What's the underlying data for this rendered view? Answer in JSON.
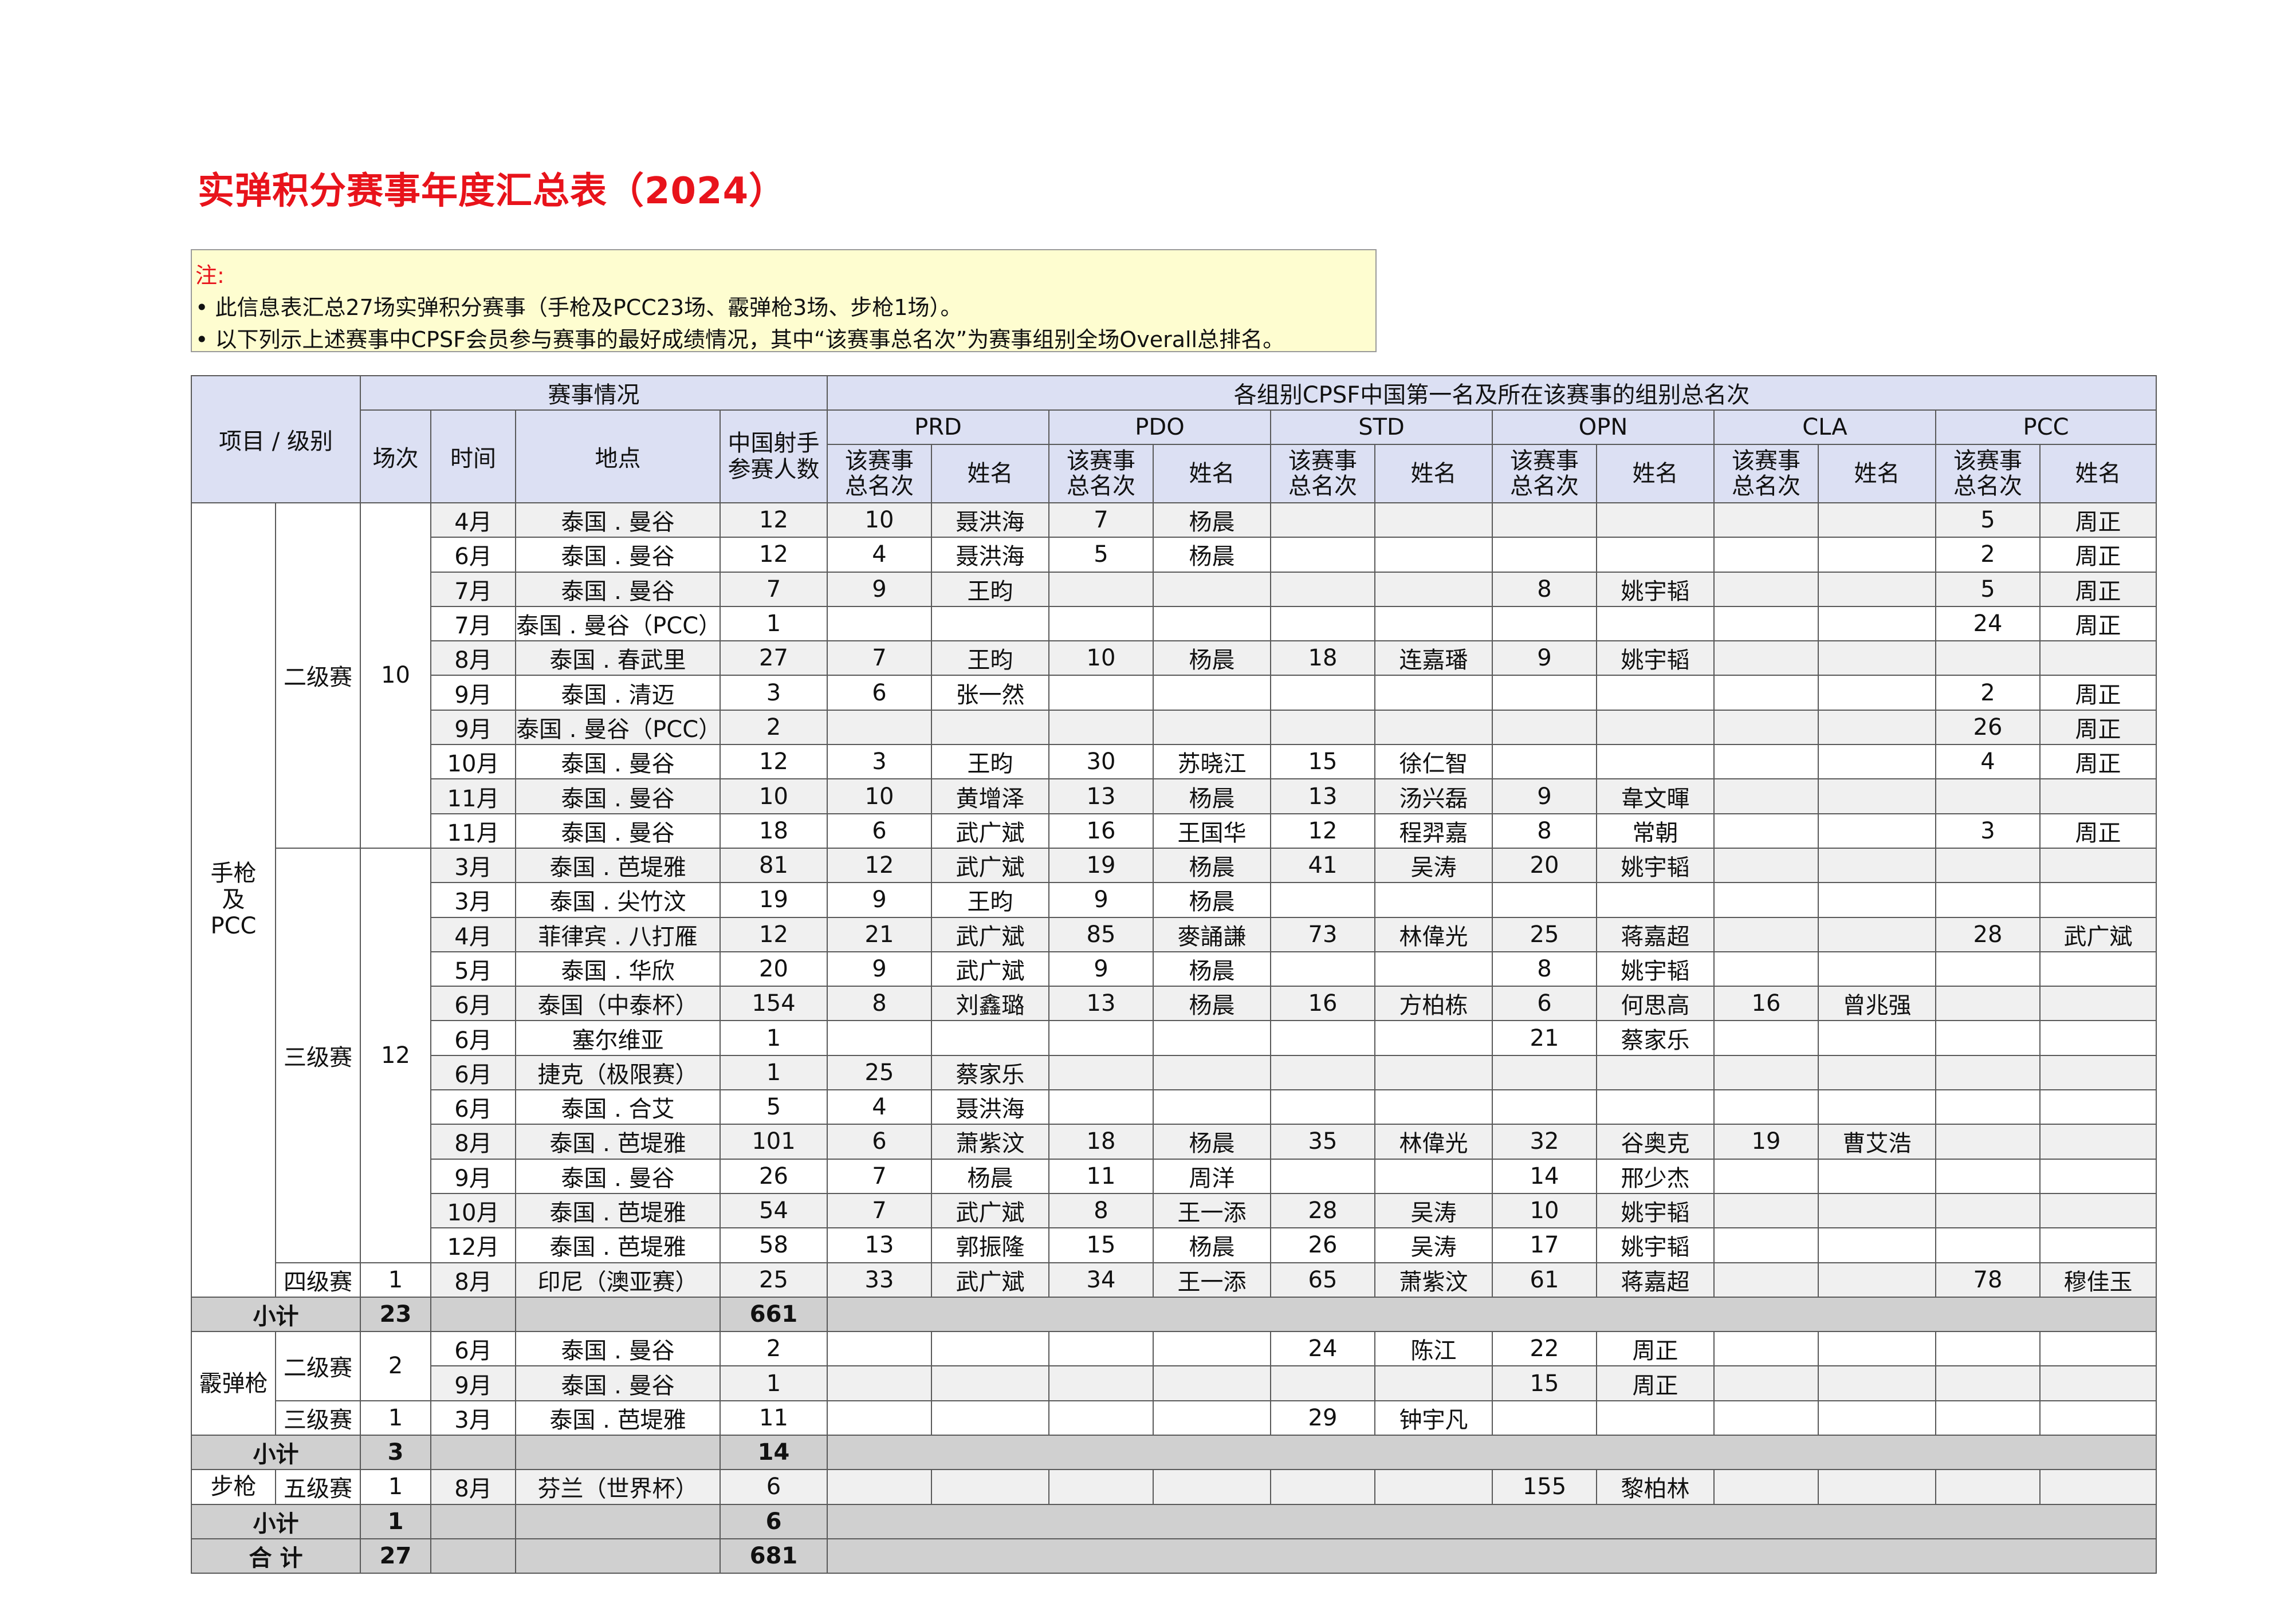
{
  "title": "实弹积分赛事年度汇总表（2024）",
  "note": {
    "label": "注:",
    "lines": [
      "• 此信息表汇总27场实弹积分赛事（手枪及PCC23场、霰弹枪3场、步枪1场）。",
      "• 以下列示上述赛事中CPSF会员参与赛事的最好成绩情况，其中“该赛事总名次”为赛事组别全场Overall总排名。"
    ]
  },
  "header": {
    "item_level": "项目 / 级别",
    "event_info": "赛事情况",
    "results_header": "各组别CPSF中国第一名及所在该赛事的组别总名次",
    "count": "场次",
    "time": "时间",
    "location": "地点",
    "participants": "中国射手参赛人数",
    "divisions": [
      "PRD",
      "PDO",
      "STD",
      "OPN",
      "CLA",
      "PCC"
    ],
    "rank_label": "该赛事总名次",
    "name_label": "姓名"
  },
  "categories": {
    "handgun": "手枪及PCC",
    "shotgun": "霰弹枪",
    "rifle": "步枪"
  },
  "levels": {
    "l2": "二级赛",
    "l3": "三级赛",
    "l4": "四级赛",
    "l5": "五级赛"
  },
  "level_counts": {
    "hg_l2": "10",
    "hg_l3": "12",
    "hg_l4": "1",
    "sg_l2": "2",
    "sg_l3": "1",
    "rf_l5": "1"
  },
  "rows": [
    {
      "time": "4月",
      "loc": "泰国 . 曼谷",
      "n": "12",
      "prd_r": "10",
      "prd_n": "聂洪海",
      "pdo_r": "7",
      "pdo_n": "杨晨",
      "std_r": "",
      "std_n": "",
      "opn_r": "",
      "opn_n": "",
      "cla_r": "",
      "cla_n": "",
      "pcc_r": "5",
      "pcc_n": "周正"
    },
    {
      "time": "6月",
      "loc": "泰国 . 曼谷",
      "n": "12",
      "prd_r": "4",
      "prd_n": "聂洪海",
      "pdo_r": "5",
      "pdo_n": "杨晨",
      "std_r": "",
      "std_n": "",
      "opn_r": "",
      "opn_n": "",
      "cla_r": "",
      "cla_n": "",
      "pcc_r": "2",
      "pcc_n": "周正"
    },
    {
      "time": "7月",
      "loc": "泰国 . 曼谷",
      "n": "7",
      "prd_r": "9",
      "prd_n": "王昀",
      "pdo_r": "",
      "pdo_n": "",
      "std_r": "",
      "std_n": "",
      "opn_r": "8",
      "opn_n": "姚宇韬",
      "cla_r": "",
      "cla_n": "",
      "pcc_r": "5",
      "pcc_n": "周正"
    },
    {
      "time": "7月",
      "loc": "泰国 . 曼谷（PCC）",
      "n": "1",
      "prd_r": "",
      "prd_n": "",
      "pdo_r": "",
      "pdo_n": "",
      "std_r": "",
      "std_n": "",
      "opn_r": "",
      "opn_n": "",
      "cla_r": "",
      "cla_n": "",
      "pcc_r": "24",
      "pcc_n": "周正"
    },
    {
      "time": "8月",
      "loc": "泰国 . 春武里",
      "n": "27",
      "prd_r": "7",
      "prd_n": "王昀",
      "pdo_r": "10",
      "pdo_n": "杨晨",
      "std_r": "18",
      "std_n": "连嘉璠",
      "opn_r": "9",
      "opn_n": "姚宇韬",
      "cla_r": "",
      "cla_n": "",
      "pcc_r": "",
      "pcc_n": ""
    },
    {
      "time": "9月",
      "loc": "泰国 . 清迈",
      "n": "3",
      "prd_r": "6",
      "prd_n": "张一然",
      "pdo_r": "",
      "pdo_n": "",
      "std_r": "",
      "std_n": "",
      "opn_r": "",
      "opn_n": "",
      "cla_r": "",
      "cla_n": "",
      "pcc_r": "2",
      "pcc_n": "周正"
    },
    {
      "time": "9月",
      "loc": "泰国 . 曼谷（PCC）",
      "n": "2",
      "prd_r": "",
      "prd_n": "",
      "pdo_r": "",
      "pdo_n": "",
      "std_r": "",
      "std_n": "",
      "opn_r": "",
      "opn_n": "",
      "cla_r": "",
      "cla_n": "",
      "pcc_r": "26",
      "pcc_n": "周正"
    },
    {
      "time": "10月",
      "loc": "泰国 . 曼谷",
      "n": "12",
      "prd_r": "3",
      "prd_n": "王昀",
      "pdo_r": "30",
      "pdo_n": "苏晓江",
      "std_r": "15",
      "std_n": "徐仁智",
      "opn_r": "",
      "opn_n": "",
      "cla_r": "",
      "cla_n": "",
      "pcc_r": "4",
      "pcc_n": "周正"
    },
    {
      "time": "11月",
      "loc": "泰国 . 曼谷",
      "n": "10",
      "prd_r": "10",
      "prd_n": "黄增泽",
      "pdo_r": "13",
      "pdo_n": "杨晨",
      "std_r": "13",
      "std_n": "汤兴磊",
      "opn_r": "9",
      "opn_n": "韋文暉",
      "cla_r": "",
      "cla_n": "",
      "pcc_r": "",
      "pcc_n": ""
    },
    {
      "time": "11月",
      "loc": "泰国 . 曼谷",
      "n": "18",
      "prd_r": "6",
      "prd_n": "武广斌",
      "pdo_r": "16",
      "pdo_n": "王国华",
      "std_r": "12",
      "std_n": "程羿嘉",
      "opn_r": "8",
      "opn_n": "常朝",
      "cla_r": "",
      "cla_n": "",
      "pcc_r": "3",
      "pcc_n": "周正"
    },
    {
      "time": "3月",
      "loc": "泰国 . 芭堤雅",
      "n": "81",
      "prd_r": "12",
      "prd_n": "武广斌",
      "pdo_r": "19",
      "pdo_n": "杨晨",
      "std_r": "41",
      "std_n": "吴涛",
      "opn_r": "20",
      "opn_n": "姚宇韬",
      "cla_r": "",
      "cla_n": "",
      "pcc_r": "",
      "pcc_n": ""
    },
    {
      "time": "3月",
      "loc": "泰国 . 尖竹汶",
      "n": "19",
      "prd_r": "9",
      "prd_n": "王昀",
      "pdo_r": "9",
      "pdo_n": "杨晨",
      "std_r": "",
      "std_n": "",
      "opn_r": "",
      "opn_n": "",
      "cla_r": "",
      "cla_n": "",
      "pcc_r": "",
      "pcc_n": ""
    },
    {
      "time": "4月",
      "loc": "菲律宾 . 八打雁",
      "n": "12",
      "prd_r": "21",
      "prd_n": "武广斌",
      "pdo_r": "85",
      "pdo_n": "麥誦謙",
      "std_r": "73",
      "std_n": "林偉光",
      "opn_r": "25",
      "opn_n": "蒋嘉超",
      "cla_r": "",
      "cla_n": "",
      "pcc_r": "28",
      "pcc_n": "武广斌"
    },
    {
      "time": "5月",
      "loc": "泰国 . 华欣",
      "n": "20",
      "prd_r": "9",
      "prd_n": "武广斌",
      "pdo_r": "9",
      "pdo_n": "杨晨",
      "std_r": "",
      "std_n": "",
      "opn_r": "8",
      "opn_n": "姚宇韬",
      "cla_r": "",
      "cla_n": "",
      "pcc_r": "",
      "pcc_n": ""
    },
    {
      "time": "6月",
      "loc": "泰国（中泰杯）",
      "n": "154",
      "prd_r": "8",
      "prd_n": "刘鑫璐",
      "pdo_r": "13",
      "pdo_n": "杨晨",
      "std_r": "16",
      "std_n": "方柏栋",
      "opn_r": "6",
      "opn_n": "何思高",
      "cla_r": "16",
      "cla_n": "曾兆强",
      "pcc_r": "",
      "pcc_n": ""
    },
    {
      "time": "6月",
      "loc": "塞尔维亚",
      "n": "1",
      "prd_r": "",
      "prd_n": "",
      "pdo_r": "",
      "pdo_n": "",
      "std_r": "",
      "std_n": "",
      "opn_r": "21",
      "opn_n": "蔡家乐",
      "cla_r": "",
      "cla_n": "",
      "pcc_r": "",
      "pcc_n": ""
    },
    {
      "time": "6月",
      "loc": "捷克（极限赛）",
      "n": "1",
      "prd_r": "25",
      "prd_n": "蔡家乐",
      "pdo_r": "",
      "pdo_n": "",
      "std_r": "",
      "std_n": "",
      "opn_r": "",
      "opn_n": "",
      "cla_r": "",
      "cla_n": "",
      "pcc_r": "",
      "pcc_n": ""
    },
    {
      "time": "6月",
      "loc": "泰国 . 合艾",
      "n": "5",
      "prd_r": "4",
      "prd_n": "聂洪海",
      "pdo_r": "",
      "pdo_n": "",
      "std_r": "",
      "std_n": "",
      "opn_r": "",
      "opn_n": "",
      "cla_r": "",
      "cla_n": "",
      "pcc_r": "",
      "pcc_n": ""
    },
    {
      "time": "8月",
      "loc": "泰国 . 芭堤雅",
      "n": "101",
      "prd_r": "6",
      "prd_n": "萧紫汶",
      "pdo_r": "18",
      "pdo_n": "杨晨",
      "std_r": "35",
      "std_n": "林偉光",
      "opn_r": "32",
      "opn_n": "谷奥克",
      "cla_r": "19",
      "cla_n": "曹艾浩",
      "pcc_r": "",
      "pcc_n": ""
    },
    {
      "time": "9月",
      "loc": "泰国 . 曼谷",
      "n": "26",
      "prd_r": "7",
      "prd_n": "杨晨",
      "pdo_r": "11",
      "pdo_n": "周洋",
      "std_r": "",
      "std_n": "",
      "opn_r": "14",
      "opn_n": "邢少杰",
      "cla_r": "",
      "cla_n": "",
      "pcc_r": "",
      "pcc_n": ""
    },
    {
      "time": "10月",
      "loc": "泰国 . 芭堤雅",
      "n": "54",
      "prd_r": "7",
      "prd_n": "武广斌",
      "pdo_r": "8",
      "pdo_n": "王一添",
      "std_r": "28",
      "std_n": "吴涛",
      "opn_r": "10",
      "opn_n": "姚宇韬",
      "cla_r": "",
      "cla_n": "",
      "pcc_r": "",
      "pcc_n": ""
    },
    {
      "time": "12月",
      "loc": "泰国 . 芭堤雅",
      "n": "58",
      "prd_r": "13",
      "prd_n": "郭振隆",
      "pdo_r": "15",
      "pdo_n": "杨晨",
      "std_r": "26",
      "std_n": "吴涛",
      "opn_r": "17",
      "opn_n": "姚宇韬",
      "cla_r": "",
      "cla_n": "",
      "pcc_r": "",
      "pcc_n": ""
    },
    {
      "time": "8月",
      "loc": "印尼（澳亚赛）",
      "n": "25",
      "prd_r": "33",
      "prd_n": "武广斌",
      "pdo_r": "34",
      "pdo_n": "王一添",
      "std_r": "65",
      "std_n": "萧紫汶",
      "opn_r": "61",
      "opn_n": "蒋嘉超",
      "cla_r": "",
      "cla_n": "",
      "pcc_r": "78",
      "pcc_n": "穆佳玉"
    },
    {
      "time": "6月",
      "loc": "泰国 . 曼谷",
      "n": "2",
      "prd_r": "",
      "prd_n": "",
      "pdo_r": "",
      "pdo_n": "",
      "std_r": "24",
      "std_n": "陈江",
      "opn_r": "22",
      "opn_n": "周正",
      "cla_r": "",
      "cla_n": "",
      "pcc_r": "",
      "pcc_n": ""
    },
    {
      "time": "9月",
      "loc": "泰国 . 曼谷",
      "n": "1",
      "prd_r": "",
      "prd_n": "",
      "pdo_r": "",
      "pdo_n": "",
      "std_r": "",
      "std_n": "",
      "opn_r": "15",
      "opn_n": "周正",
      "cla_r": "",
      "cla_n": "",
      "pcc_r": "",
      "pcc_n": ""
    },
    {
      "time": "3月",
      "loc": "泰国 . 芭堤雅",
      "n": "11",
      "prd_r": "",
      "prd_n": "",
      "pdo_r": "",
      "pdo_n": "",
      "std_r": "29",
      "std_n": "钟宇凡",
      "opn_r": "",
      "opn_n": "",
      "cla_r": "",
      "cla_n": "",
      "pcc_r": "",
      "pcc_n": ""
    },
    {
      "time": "8月",
      "loc": "芬兰（世界杯）",
      "n": "6",
      "prd_r": "",
      "prd_n": "",
      "pdo_r": "",
      "pdo_n": "",
      "std_r": "",
      "std_n": "",
      "opn_r": "155",
      "opn_n": "黎柏林",
      "cla_r": "",
      "cla_n": "",
      "pcc_r": "",
      "pcc_n": ""
    }
  ],
  "subtotals": {
    "label": "小计",
    "handgun": {
      "count": "23",
      "participants": "661"
    },
    "shotgun": {
      "count": "3",
      "participants": "14"
    },
    "rifle": {
      "count": "1",
      "participants": "6"
    }
  },
  "total": {
    "label": "合 计",
    "count": "27",
    "participants": "681"
  }
}
